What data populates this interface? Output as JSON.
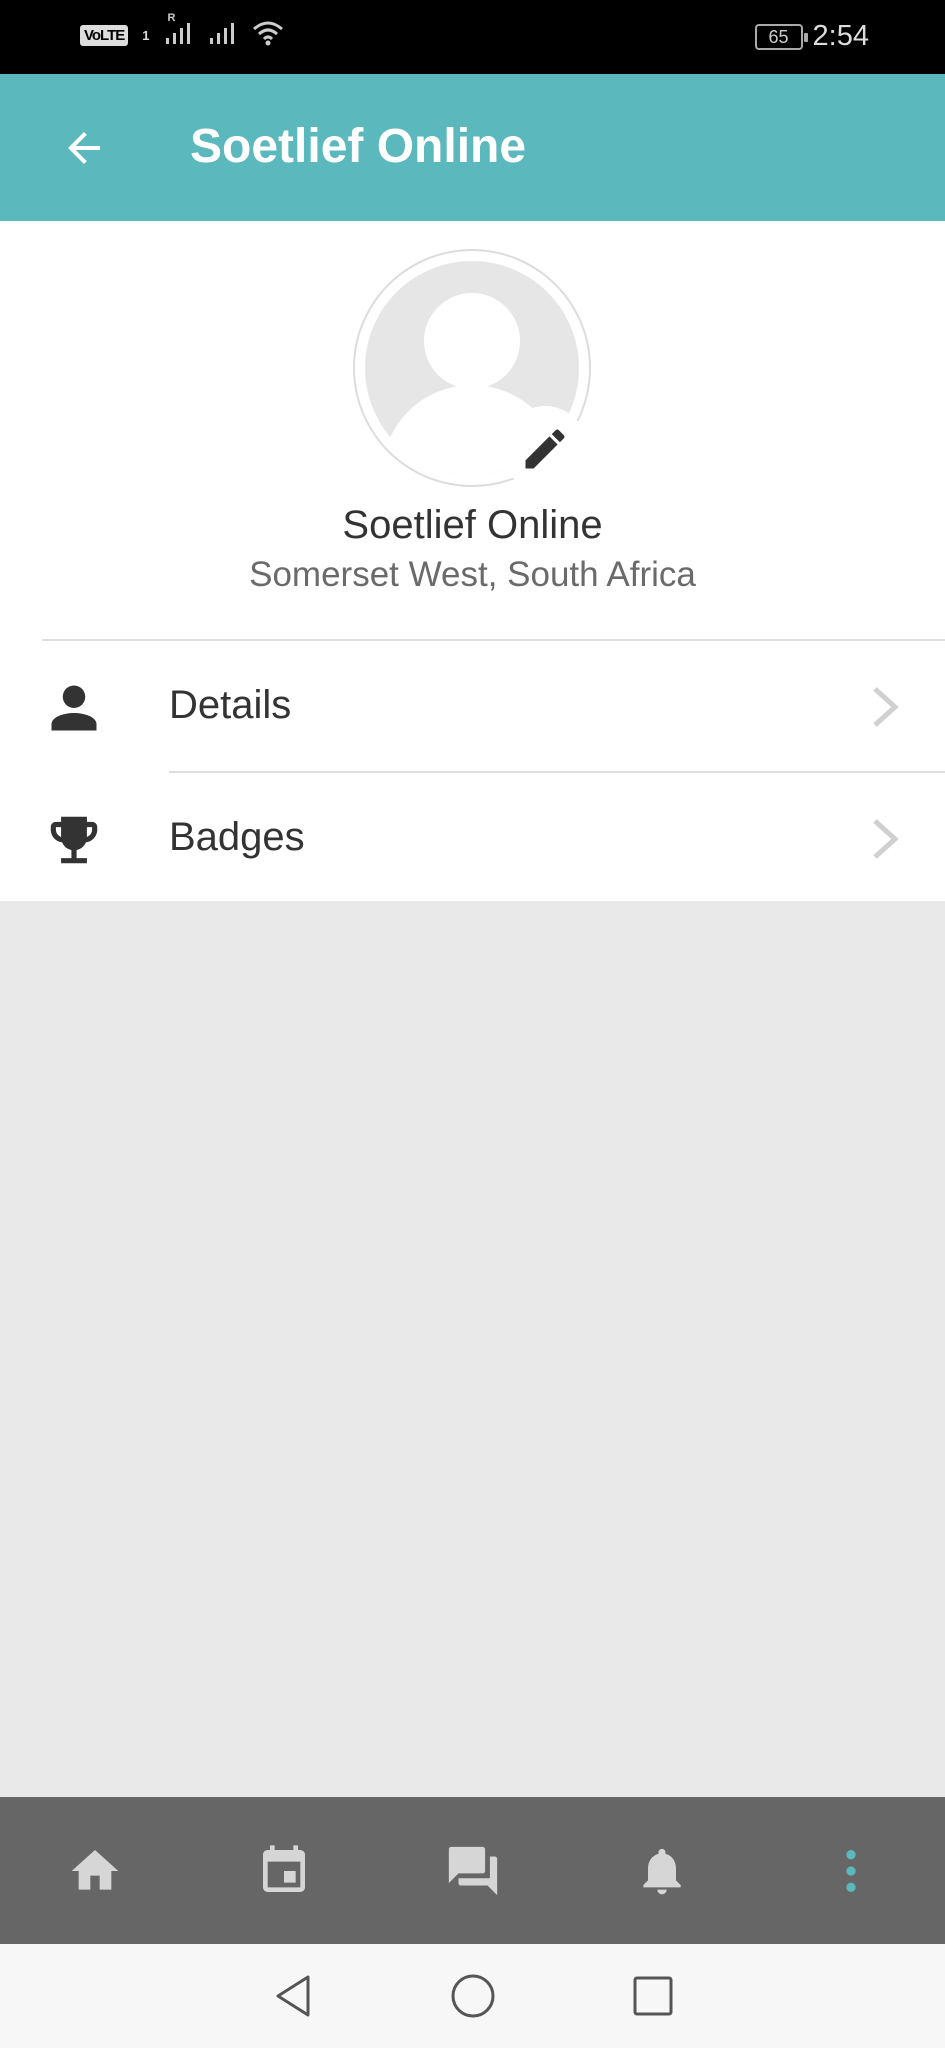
{
  "status_bar": {
    "volte": "VoLTE",
    "sim_index": "1",
    "roaming": "R",
    "battery": "65",
    "time": "2:54"
  },
  "app_bar": {
    "title": "Soetlief Online",
    "back_icon": "arrow-back-icon"
  },
  "profile": {
    "name": "Soetlief Online",
    "location": "Somerset West, South Africa",
    "avatar_icon": "person-placeholder-icon",
    "edit_icon": "pencil-icon"
  },
  "menu": [
    {
      "label": "Details",
      "icon": "person-icon"
    },
    {
      "label": "Badges",
      "icon": "trophy-icon"
    }
  ],
  "bottom_nav": [
    {
      "icon": "home-icon"
    },
    {
      "icon": "calendar-icon"
    },
    {
      "icon": "chat-icon"
    },
    {
      "icon": "bell-icon"
    },
    {
      "icon": "more-vert-icon",
      "active": true
    }
  ],
  "colors": {
    "accent": "#5bb8bc",
    "status_bar": "#000000",
    "bottom_nav": "#666666",
    "page_bg": "#e9e9e9",
    "text": "#333333",
    "icon_inactive": "#d6d6d6"
  }
}
